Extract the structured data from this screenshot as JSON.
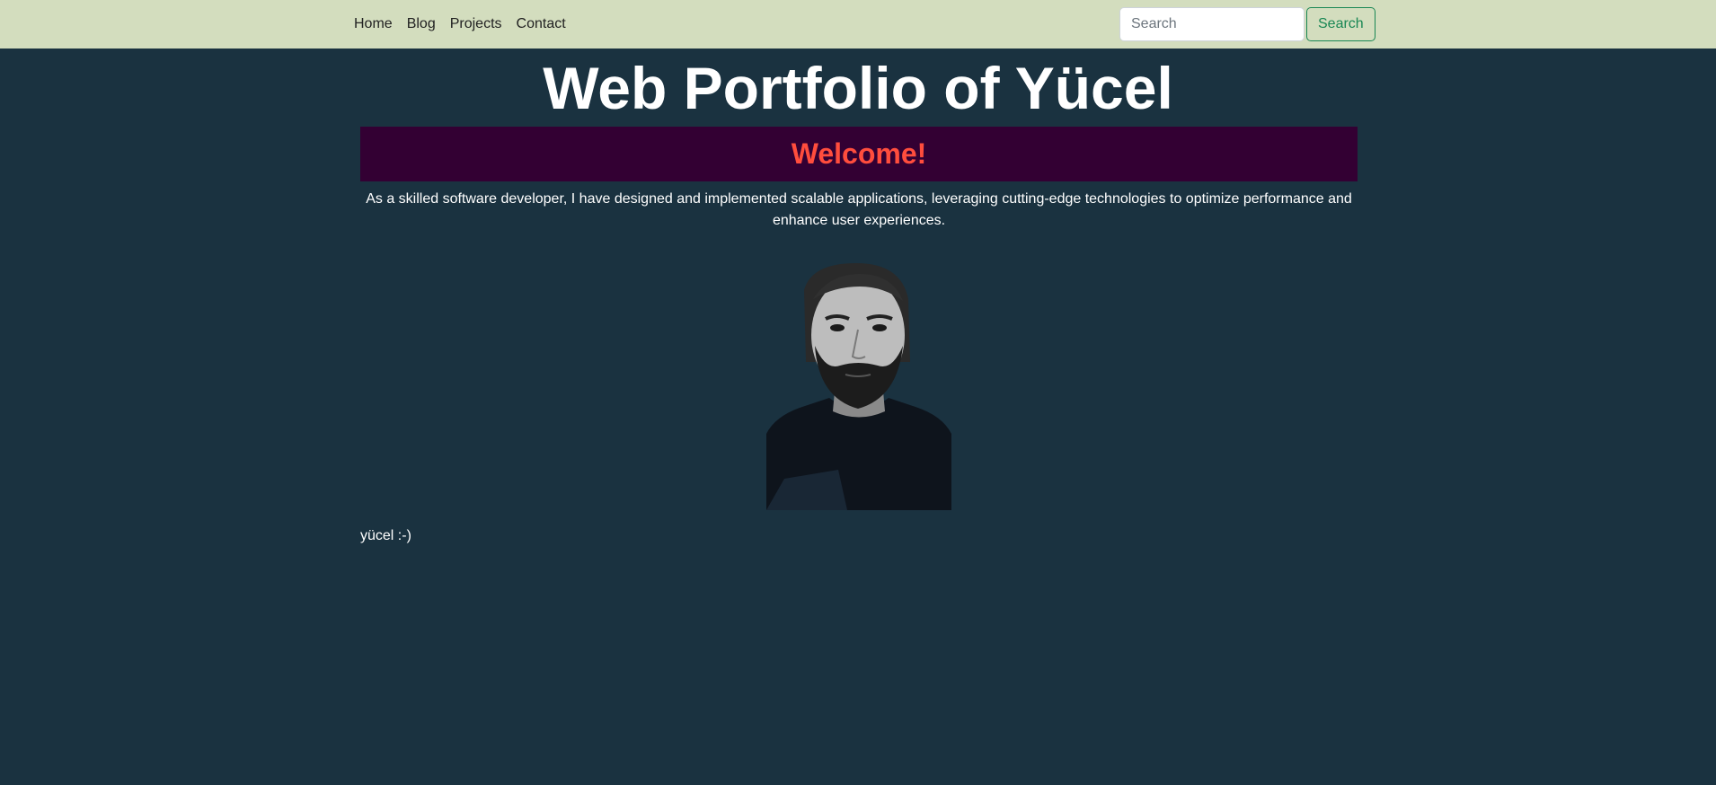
{
  "nav": {
    "links": [
      "Home",
      "Blog",
      "Projects",
      "Contact"
    ],
    "search_placeholder": "Search",
    "search_button": "Search"
  },
  "header": {
    "title": "Web Portfolio of Yücel"
  },
  "welcome": {
    "heading": "Welcome!"
  },
  "intro": {
    "text": "As a skilled software developer, I have designed and implemented scalable applications, leveraging cutting-edge technologies to optimize performance and enhance user experiences."
  },
  "footer_note": {
    "text": "yücel :-)"
  },
  "colors": {
    "page_background": "#1a3240",
    "navbar_background": "#d3ddbe",
    "banner_background": "#330033",
    "welcome_text": "#ff4d3d",
    "search_button": "#198754"
  }
}
